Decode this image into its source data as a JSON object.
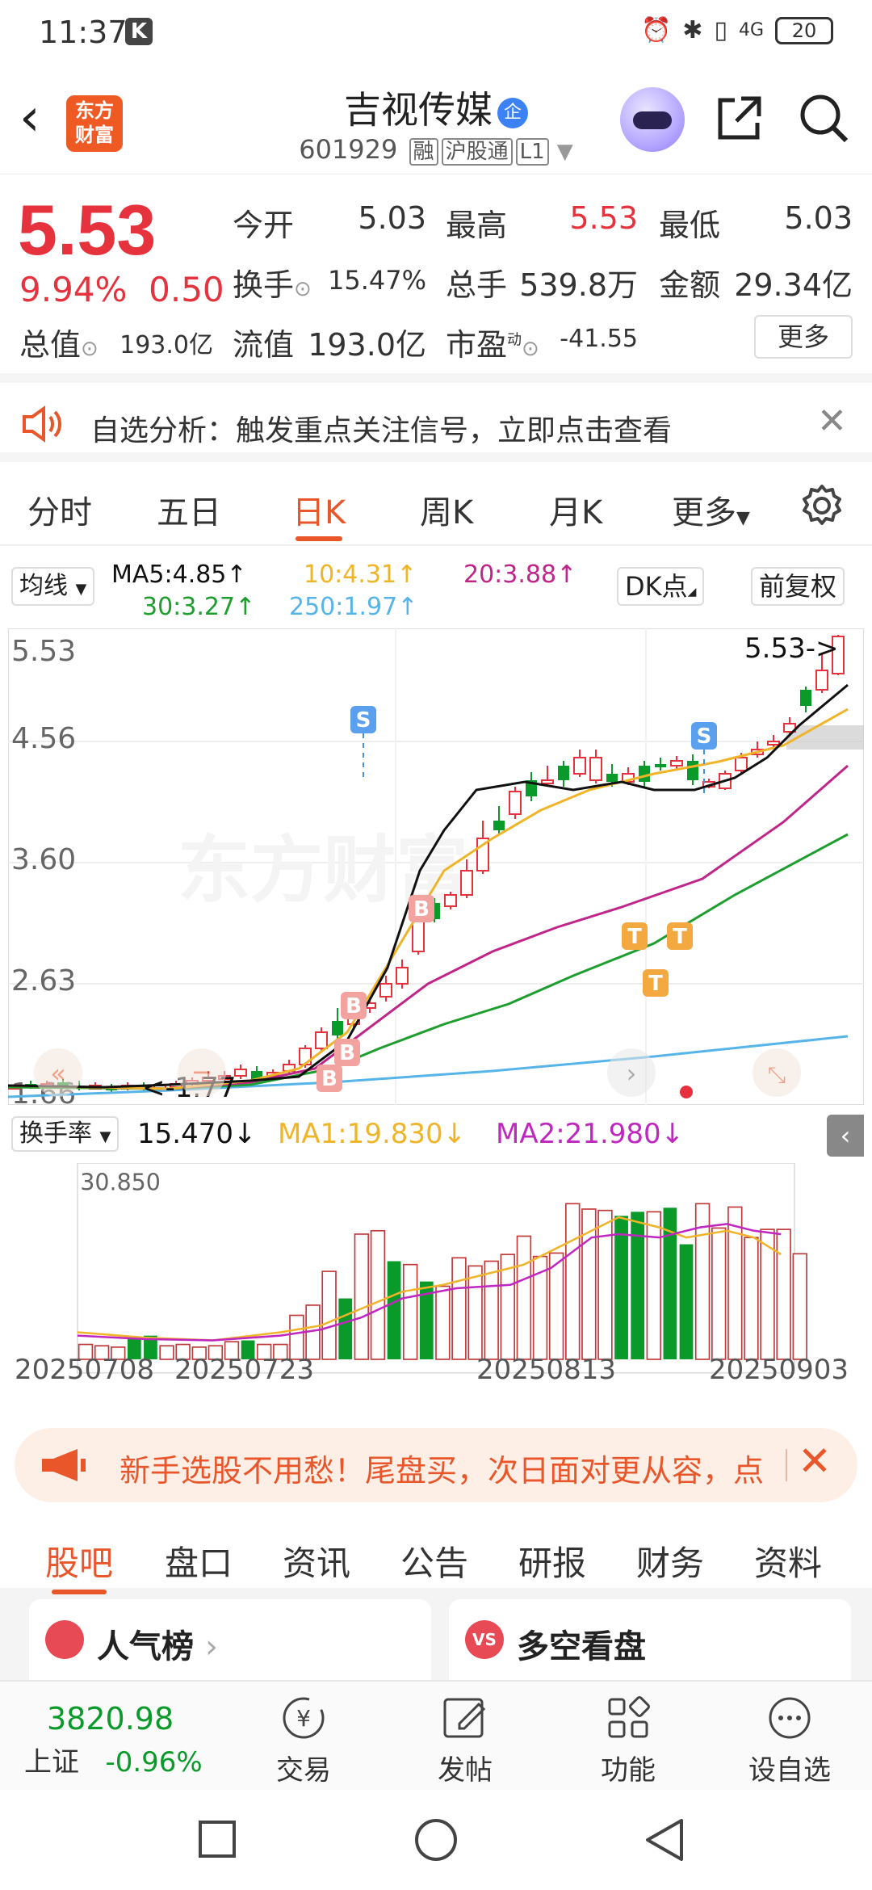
{
  "status_bar": {
    "time": "11:37",
    "k": "K",
    "net": "4G",
    "battery": "20"
  },
  "header": {
    "back": "‹",
    "logo_line1": "东方",
    "logo_line2": "财富",
    "name": "吉视传媒",
    "badge": "企",
    "code": "601929",
    "tag1": "融",
    "tag2": "沪股通",
    "tag3": "L1"
  },
  "quote": {
    "price": "5.53",
    "change_pct": "9.94%",
    "change": "0.50",
    "open_label": "今开",
    "open": "5.03",
    "high_label": "最高",
    "high": "5.53",
    "low_label": "最低",
    "low": "5.03",
    "turnover_label": "换手",
    "turnover": "15.47%",
    "volume_label": "总手",
    "volume": "539.8万",
    "amount_label": "金额",
    "amount": "29.34亿",
    "mktcap_label": "总值",
    "mktcap": "193.0亿",
    "float_label": "流值",
    "float": "193.0亿",
    "pe_label": "市盈",
    "pe_sup": "动",
    "pe": "-41.55",
    "more": "更多"
  },
  "alert": {
    "text": "自选分析：触发重点关注信号，立即点击查看"
  },
  "tabs": [
    "分时",
    "五日",
    "日K",
    "周K",
    "月K",
    "更多"
  ],
  "active_tab": "日K",
  "ma_row": {
    "selector": "均线",
    "ma5": "MA5:4.85",
    "ma10": "10:4.31",
    "ma20": "20:3.88",
    "ma30": "30:3.27",
    "ma250": "250:1.97",
    "dk_button": "DK点",
    "adj_button": "前复权",
    "arrow": "↑"
  },
  "kchart_labels": {
    "y1": "5.53",
    "y2": "4.56",
    "y3": "3.60",
    "y4": "2.63",
    "y5": "1.66",
    "price_marker": "5.53->",
    "low_marker": "<-1.77",
    "watermark": "东方财富"
  },
  "vol_row": {
    "selector": "换手率",
    "value": "15.470",
    "ma1": "MA1:19.830",
    "ma2": "MA2:21.980",
    "arrow": "↓",
    "ymax": "30.850"
  },
  "dates": [
    "20250708",
    "20250723",
    "20250813",
    "20250903"
  ],
  "promo": {
    "text": "新手选股不用愁！尾盘买，次日面对更从容，点"
  },
  "bottom_tabs": [
    "股吧",
    "盘口",
    "资讯",
    "公告",
    "研报",
    "财务",
    "资料"
  ],
  "cards": {
    "left": "人气榜",
    "right": "多空看盘",
    "left_icon": "",
    "right_icon": "VS"
  },
  "nav": {
    "index_value": "3820.98",
    "index_name": "上证",
    "index_change": "-0.96%",
    "trade": "交易",
    "post": "发帖",
    "func": "功能",
    "watch": "设自选"
  },
  "colors": {
    "up": "#e5323d",
    "down": "#0a9a2a",
    "accent": "#e8562a",
    "ma5": "#111111",
    "ma10": "#f0b429",
    "ma20": "#c0258a",
    "ma30": "#1e9e2e",
    "ma250": "#56b4e9"
  }
}
